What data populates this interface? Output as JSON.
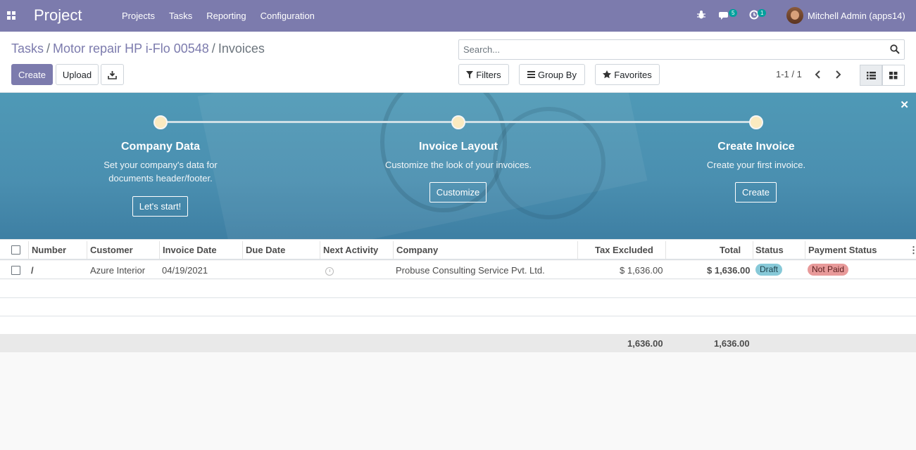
{
  "navbar": {
    "app_name": "Project",
    "menu": [
      "Projects",
      "Tasks",
      "Reporting",
      "Configuration"
    ],
    "messages_count": "5",
    "activities_count": "1",
    "user": "Mitchell Admin (apps14)"
  },
  "breadcrumb": {
    "items": [
      "Tasks",
      "Motor repair HP i-Flo 00548"
    ],
    "current": "Invoices"
  },
  "toolbar": {
    "create_label": "Create",
    "upload_label": "Upload"
  },
  "search": {
    "placeholder": "Search...",
    "filters_label": "Filters",
    "groupby_label": "Group By",
    "favorites_label": "Favorites"
  },
  "pager": {
    "value": "1-1 / 1"
  },
  "banner": {
    "steps": [
      {
        "title": "Company Data",
        "desc_line1": "Set your company's data for",
        "desc_line2": "documents header/footer.",
        "button": "Let's start!"
      },
      {
        "title": "Invoice Layout",
        "desc_line1": "Customize the look of your invoices.",
        "desc_line2": "",
        "button": "Customize"
      },
      {
        "title": "Create Invoice",
        "desc_line1": "Create your first invoice.",
        "desc_line2": "",
        "button": "Create"
      }
    ]
  },
  "table": {
    "columns": [
      "Number",
      "Customer",
      "Invoice Date",
      "Due Date",
      "Next Activity",
      "Company",
      "Tax Excluded",
      "Total",
      "Status",
      "Payment Status"
    ],
    "rows": [
      {
        "number": "/",
        "customer": "Azure Interior",
        "invoice_date": "04/19/2021",
        "due_date": "",
        "company": "Probuse Consulting Service Pvt. Ltd.",
        "tax_excluded": "$ 1,636.00",
        "total": "$ 1,636.00",
        "status": "Draft",
        "payment_status": "Not Paid"
      }
    ],
    "footer": {
      "tax_excluded": "1,636.00",
      "total": "1,636.00"
    }
  },
  "colors": {
    "brand": "#7c7bad",
    "draft_badge": "#87c9d8",
    "not_paid_badge": "#e89a9a"
  }
}
